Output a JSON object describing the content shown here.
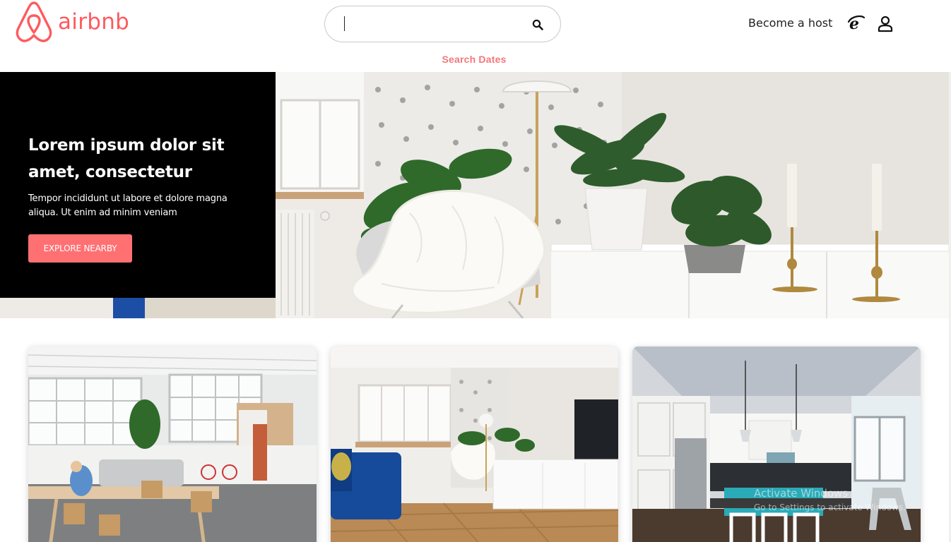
{
  "header": {
    "logo_text": "airbnb",
    "search": {
      "value": "",
      "placeholder": ""
    },
    "search_dates_label": "Search Dates",
    "host_link": "Become a host",
    "icons": [
      "airbnb-logo-icon",
      "search-icon",
      "internet-explorer-icon",
      "user-icon"
    ]
  },
  "hero": {
    "title": "Lorem ipsum dolor sit amet, consectetur",
    "subtitle": "Tempor incididunt ut labore et dolore magna aliqua. Ut enim ad minim veniam",
    "button_label": "EXPLORE NEARBY"
  },
  "cards": [
    {
      "image": "open-office-workspace"
    },
    {
      "image": "living-room-blue-sofa"
    },
    {
      "image": "kitchen-interior"
    }
  ],
  "watermark": {
    "line1": "Activate Windows",
    "line2": "Go to Settings to activate Windows."
  },
  "colors": {
    "brand": "#FF5A5F",
    "accent_button": "#FF7073",
    "search_dates": "#F2787A",
    "hero_panel": "#000000"
  }
}
